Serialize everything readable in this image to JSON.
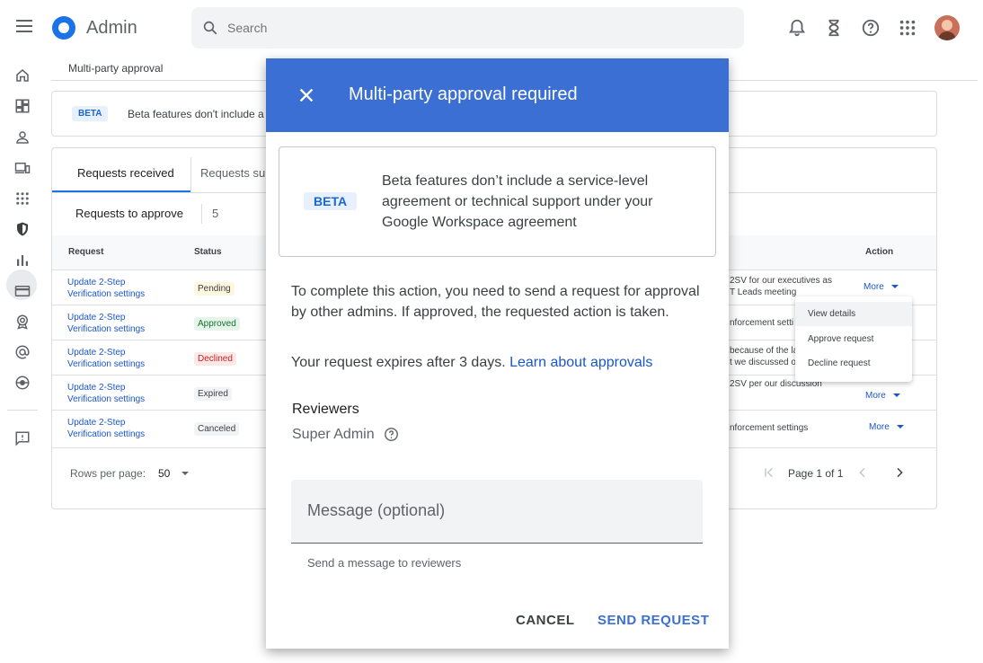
{
  "header": {
    "app_title": "Admin",
    "search_placeholder": "Search"
  },
  "breadcrumb": "Multi-party approval",
  "banner": {
    "badge": "BETA",
    "text": "Beta features don't include a"
  },
  "tabs": [
    {
      "label": "Requests received"
    },
    {
      "label": "Requests su"
    }
  ],
  "requests": {
    "title": "Requests to approve",
    "count": "5"
  },
  "table": {
    "headers": {
      "request": "Request",
      "status": "Status",
      "action": "Action"
    },
    "rows": [
      {
        "request_line1": "Update 2-Step",
        "request_line2": "Verification settings",
        "status": "Pending",
        "comment_line1": "2SV for our executives as",
        "comment_line2": "T Leads meeting",
        "action": "More"
      },
      {
        "request_line1": "Update 2-Step",
        "request_line2": "Verification settings",
        "status": "Approved",
        "comment_line1": "nforcement setti",
        "comment_line2": "",
        "action": ""
      },
      {
        "request_line1": "Update 2-Step",
        "request_line2": "Verification settings",
        "status": "Declined",
        "comment_line1": "because of the la",
        "comment_line2": "t we discussed o",
        "action": ""
      },
      {
        "request_line1": "Update 2-Step",
        "request_line2": "Verification settings",
        "status": "Expired",
        "comment_line1": "2SV per our discussion",
        "comment_line2": "",
        "action": "More"
      },
      {
        "request_line1": "Update 2-Step",
        "request_line2": "Verification settings",
        "status": "Canceled",
        "comment_line1": "nforcement settings",
        "comment_line2": "",
        "action": "More"
      }
    ]
  },
  "pagination": {
    "rows_per_page_label": "Rows per page:",
    "rows_per_page_value": "50",
    "page_text": "Page 1 of 1"
  },
  "context_menu": [
    "View details",
    "Approve request",
    "Decline request"
  ],
  "dialog": {
    "title": "Multi-party approval required",
    "beta_badge": "BETA",
    "beta_text": "Beta features don’t include a service-level agreement or technical support under your Google Workspace agreement",
    "paragraph": "To complete this action, you need to send a request for approval by other admins. If approved, the requested action is taken.",
    "expires_text": "Your request expires after 3 days.",
    "learn_link": "Learn about approvals",
    "reviewers_label": "Reviewers",
    "reviewer": "Super Admin",
    "message_placeholder": "Message (optional)",
    "message_hint": "Send a message to reviewers",
    "cancel_label": "CANCEL",
    "send_label": "SEND REQUEST"
  },
  "colors": {
    "dialog_header": "#3b6fd4",
    "link": "#1a57c8",
    "beta_chip_bg": "#e8f0fe"
  },
  "icons": [
    "menu-icon",
    "admin-logo-icon",
    "search-icon",
    "notifications-icon",
    "hourglass-icon",
    "help-icon",
    "apps-icon",
    "home-icon",
    "dashboard-icon",
    "user-icon",
    "devices-icon",
    "apps-grid-icon",
    "security-shield-icon",
    "reports-icon",
    "billing-icon",
    "account-icon",
    "at-sign-icon",
    "rules-icon",
    "feedback-icon",
    "close-icon"
  ]
}
